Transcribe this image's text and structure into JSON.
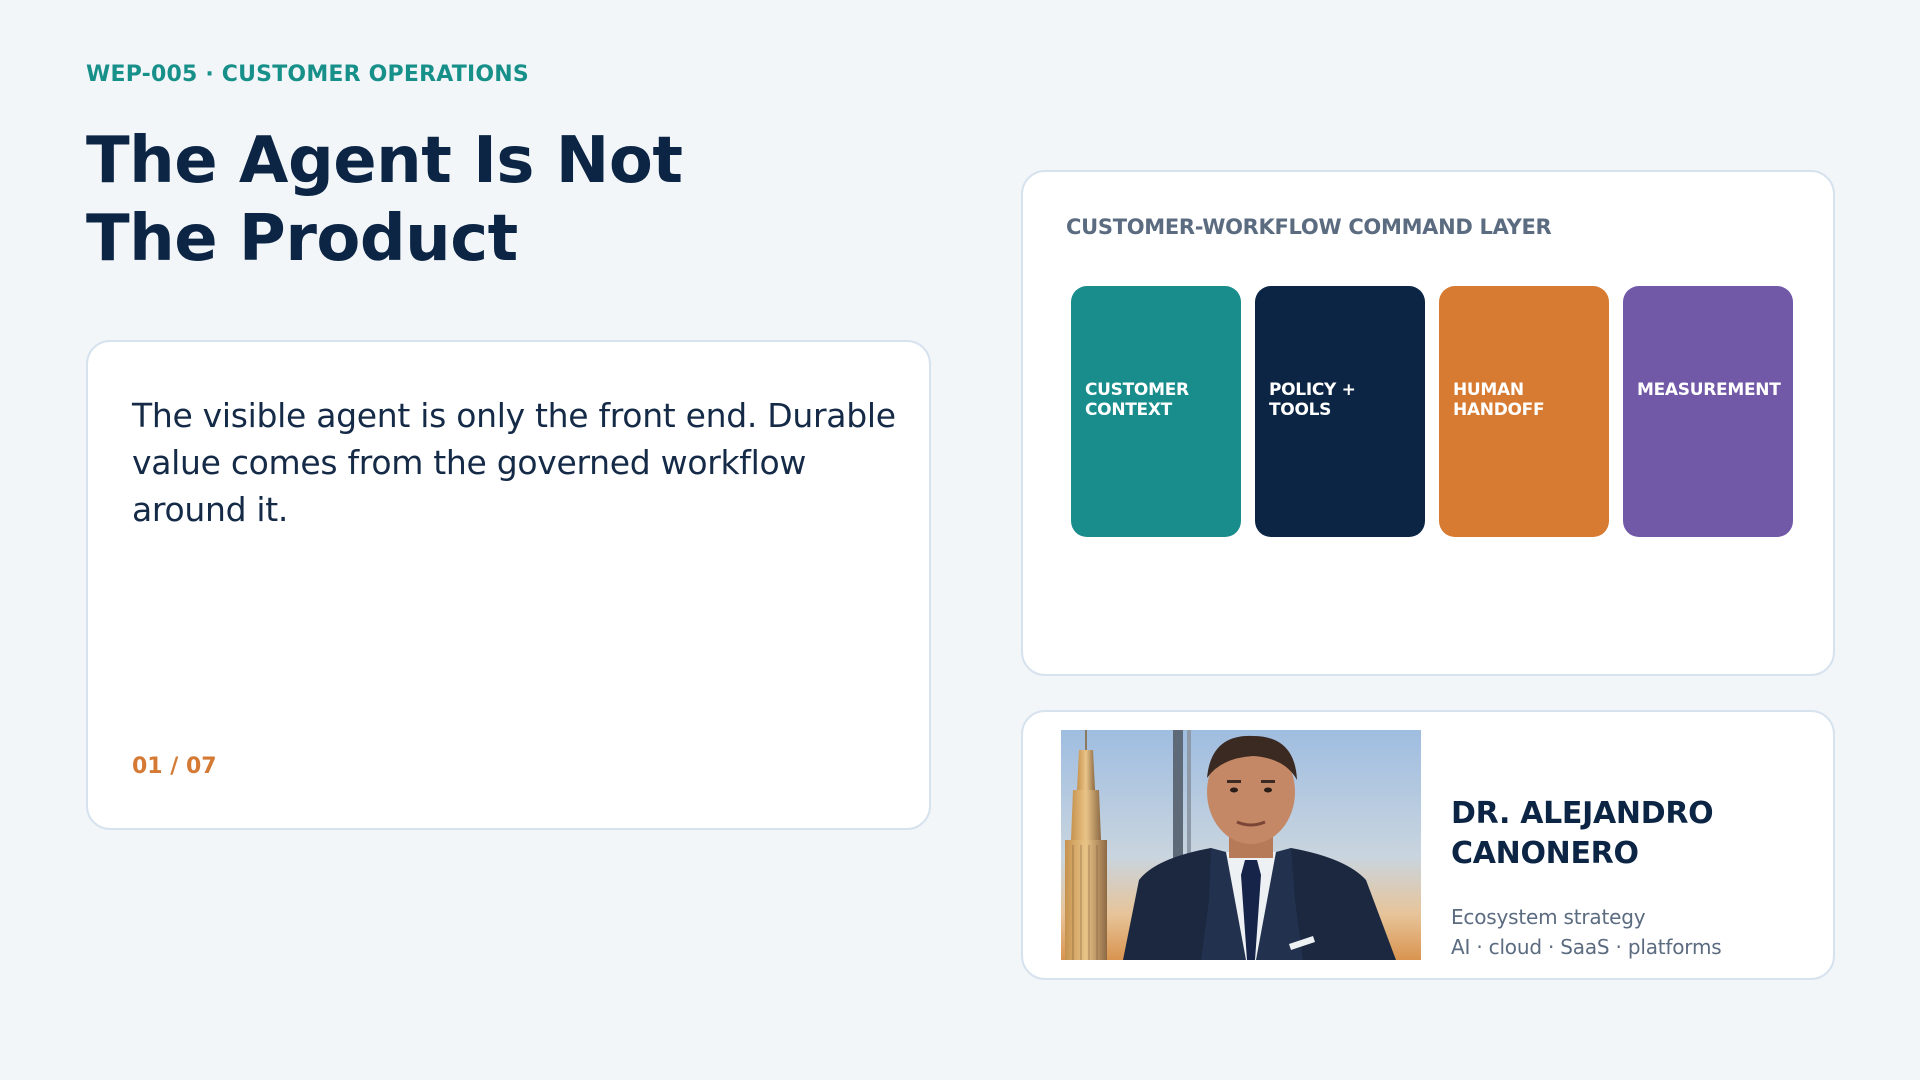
{
  "header": {
    "eyebrow": "WEP-005 · CUSTOMER OPERATIONS",
    "title_lines": [
      "The Agent Is Not",
      "The Product"
    ]
  },
  "quote_card": {
    "text": "The visible agent is only the front end. Durable value comes from the governed workflow around it.",
    "slide_counter": "01 / 07"
  },
  "command_layer": {
    "heading": "CUSTOMER-WORKFLOW COMMAND LAYER",
    "tiles": [
      {
        "lines": [
          "CUSTOMER",
          "CONTEXT"
        ],
        "color": "#188d8b"
      },
      {
        "lines": [
          "POLICY +",
          "TOOLS"
        ],
        "color": "#0c2545"
      },
      {
        "lines": [
          "HUMAN",
          "HANDOFF"
        ],
        "color": "#d77b33"
      },
      {
        "lines": [
          "MEASUREMENT"
        ],
        "color": "#7159a8"
      }
    ]
  },
  "speaker": {
    "name_lines": [
      "DR. ALEJANDRO",
      "CANONERO"
    ],
    "meta_lines": [
      "Ecosystem strategy",
      "AI · cloud · SaaS · platforms"
    ]
  },
  "colors": {
    "background": "#f3f6f9",
    "teal_accent": "#18908a",
    "navy": "#0c2545",
    "orange_accent": "#d47a34",
    "muted_text": "#5b6b80",
    "card_border": "#d6e2ee"
  }
}
